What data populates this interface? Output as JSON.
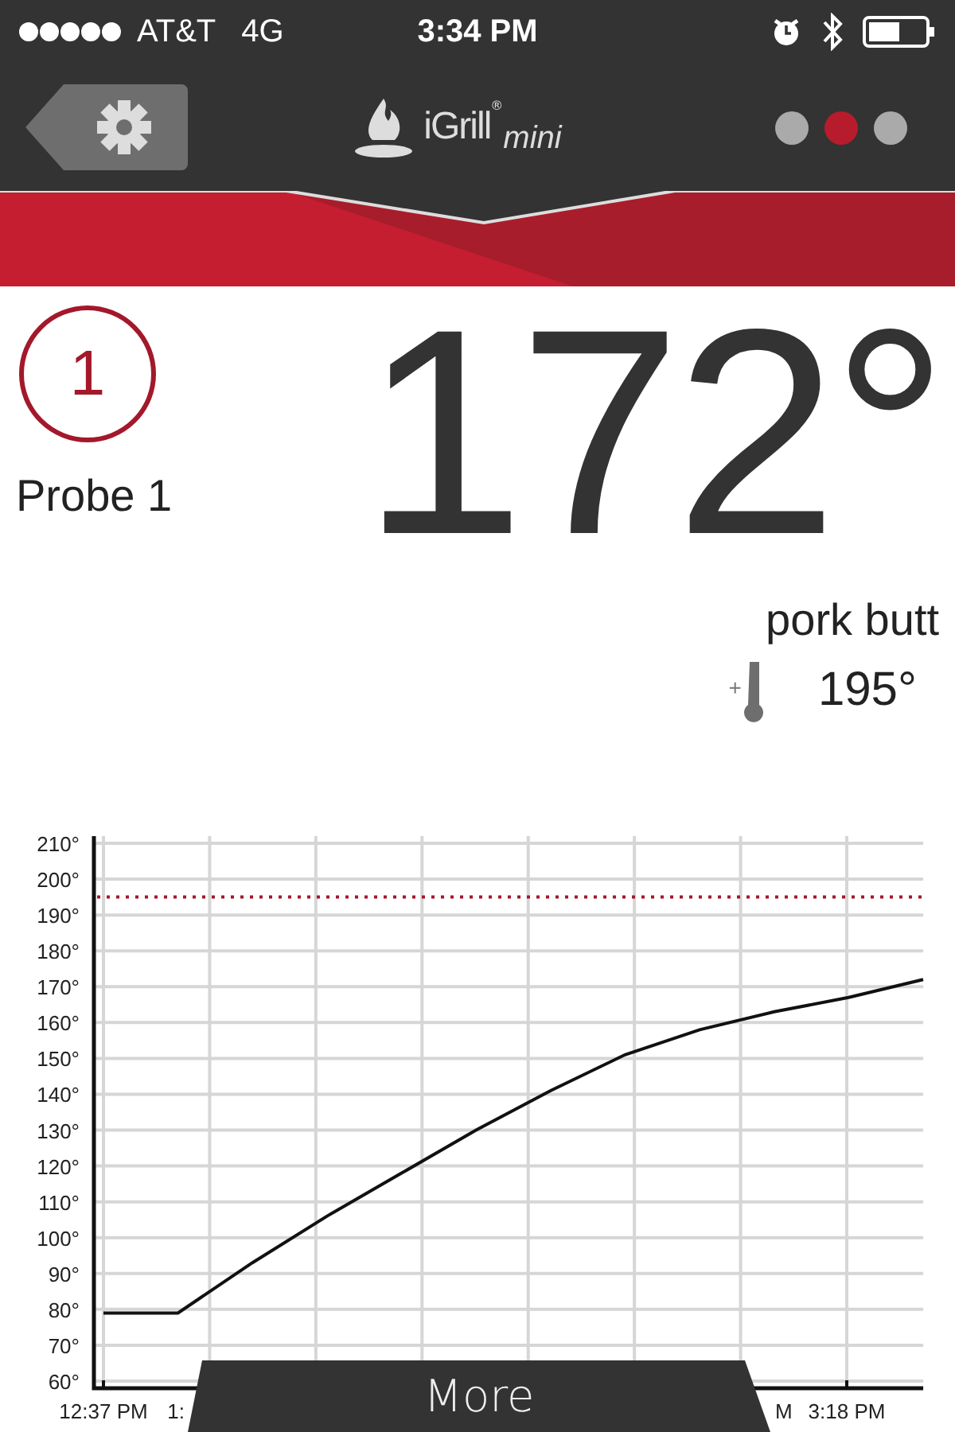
{
  "status_bar": {
    "carrier": "AT&T",
    "network": "4G",
    "time": "3:34 PM"
  },
  "header": {
    "logo": {
      "name": "iGrill",
      "mark": "®",
      "suffix": "mini"
    },
    "pages": [
      {
        "selected": false
      },
      {
        "selected": true
      },
      {
        "selected": false
      }
    ]
  },
  "probe": {
    "number": "1",
    "name": "Probe 1",
    "temperature": "172°",
    "preset": "pork butt",
    "target_sign": "+",
    "target": "195°"
  },
  "chart": {
    "time_labels": [
      "12:37 PM",
      "1:",
      "M",
      "3:18 PM"
    ],
    "chart_data": {
      "type": "line",
      "categories": [
        null,
        null,
        null,
        null,
        null,
        null,
        null,
        null,
        null,
        null,
        null,
        null
      ],
      "series": [
        {
          "color": "#111111",
          "values": [
            79,
            79,
            93,
            106,
            118,
            130,
            141,
            151,
            158,
            163,
            167,
            172
          ]
        }
      ],
      "ylim": [
        58,
        212
      ],
      "grid": true,
      "ref_lines": [
        {
          "axis": "y",
          "value": 195
        }
      ],
      "yticks": [
        {
          "value": 60,
          "label": "60°"
        },
        {
          "value": 70,
          "label": "70°"
        },
        {
          "value": 80,
          "label": "80°"
        },
        {
          "value": 90,
          "label": "90°"
        },
        {
          "value": 100,
          "label": "100°"
        },
        {
          "value": 110,
          "label": "110°"
        },
        {
          "value": 120,
          "label": "120°"
        },
        {
          "value": 130,
          "label": "130°"
        },
        {
          "value": 140,
          "label": "140°"
        },
        {
          "value": 150,
          "label": "150°"
        },
        {
          "value": 160,
          "label": "160°"
        },
        {
          "value": 170,
          "label": "170°"
        },
        {
          "value": 180,
          "label": "180°"
        },
        {
          "value": 190,
          "label": "190°"
        },
        {
          "value": 200,
          "label": "200°"
        },
        {
          "value": 210,
          "label": "210°"
        }
      ]
    }
  },
  "more_button": {
    "label": "More"
  }
}
